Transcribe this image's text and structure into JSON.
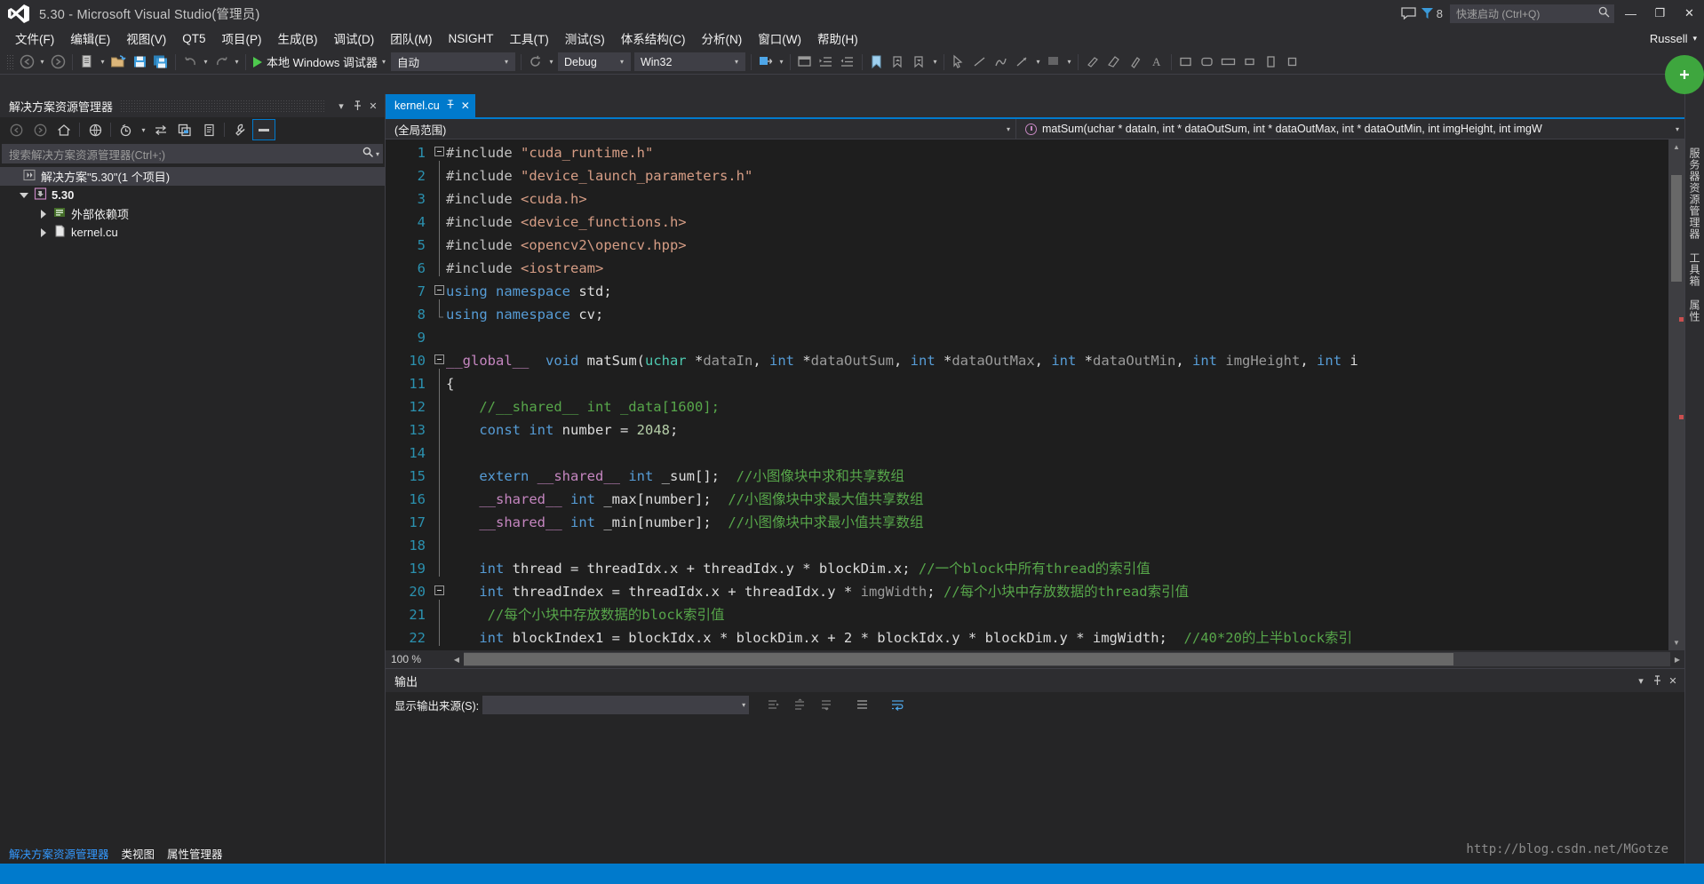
{
  "window": {
    "title": "5.30 - Microsoft Visual Studio(管理员)",
    "logo_name": "visual-studio-logo",
    "notification_count": "8",
    "minimize": "—",
    "maximize": "❐",
    "close": "✕",
    "user": "Russell",
    "user_caret": "▾"
  },
  "quick_launch": {
    "placeholder": "快速启动 (Ctrl+Q)",
    "value": "",
    "icon": "search-icon"
  },
  "menu": {
    "items": [
      {
        "label": "文件(F)",
        "mnemonic": "F"
      },
      {
        "label": "编辑(E)",
        "mnemonic": "E"
      },
      {
        "label": "视图(V)",
        "mnemonic": "V"
      },
      {
        "label": "QT5",
        "mnemonic": "T"
      },
      {
        "label": "项目(P)",
        "mnemonic": "P"
      },
      {
        "label": "生成(B)",
        "mnemonic": "B"
      },
      {
        "label": "调试(D)",
        "mnemonic": "D"
      },
      {
        "label": "团队(M)",
        "mnemonic": "M"
      },
      {
        "label": "NSIGHT",
        "mnemonic": "N"
      },
      {
        "label": "工具(T)",
        "mnemonic": "T"
      },
      {
        "label": "测试(S)",
        "mnemonic": "S"
      },
      {
        "label": "体系结构(C)",
        "mnemonic": "C"
      },
      {
        "label": "分析(N)",
        "mnemonic": "N"
      },
      {
        "label": "窗口(W)",
        "mnemonic": "W"
      },
      {
        "label": "帮助(H)",
        "mnemonic": "H"
      }
    ]
  },
  "toolbar": {
    "navigate_back": "navigate-back-icon",
    "navigate_forward": "navigate-forward-icon",
    "new_project": "new-project-icon",
    "open_file": "open-file-icon",
    "save": "save-icon",
    "save_all": "save-all-icon",
    "undo": "undo-icon",
    "redo": "redo-icon",
    "start_debug_label": "本地 Windows 调试器",
    "debug_target": "自动",
    "refresh": "refresh-icon",
    "configuration": "Debug",
    "platform": "Win32"
  },
  "solution_explorer": {
    "title": "解决方案资源管理器",
    "dropdown_icon": "chevron-down-icon",
    "pin_icon": "pin-icon",
    "close_icon": "close-icon",
    "toolbar_icons": [
      "back-icon",
      "forward-icon",
      "home-icon",
      "pending-changes-icon",
      "show-all-files-icon",
      "refresh-icon",
      "collapse-all-icon",
      "view-code-icon",
      "properties-icon",
      "preview-selected-items-icon"
    ],
    "search_placeholder": "搜索解决方案资源管理器(Ctrl+;)",
    "search_value": "",
    "tree": [
      {
        "label": "解决方案\"5.30\"(1 个项目)",
        "icon": "solution-icon",
        "indent": 0,
        "expander": "none",
        "selected": true,
        "bold": false
      },
      {
        "label": "5.30",
        "icon": "project-icon",
        "indent": 1,
        "expander": "down",
        "selected": false,
        "bold": true
      },
      {
        "label": "外部依赖项",
        "icon": "external-dependencies-icon",
        "indent": 2,
        "expander": "right",
        "selected": false,
        "bold": false
      },
      {
        "label": "kernel.cu",
        "icon": "cuda-file-icon",
        "indent": 2,
        "expander": "right",
        "selected": false,
        "bold": false
      }
    ],
    "bottom_tabs": [
      {
        "label": "解决方案资源管理器",
        "active": true
      },
      {
        "label": "类视图",
        "active": false
      },
      {
        "label": "属性管理器",
        "active": false
      }
    ]
  },
  "editor": {
    "tab": {
      "label": "kernel.cu",
      "pin": "pin-icon",
      "close": "✕"
    },
    "nav_scope": "(全局范围)",
    "nav_member": "matSum(uchar * dataIn, int * dataOutSum, int * dataOutMax, int * dataOutMin, int imgHeight, int imgW",
    "nav_member_icon": "method-icon",
    "zoom_level": "100 %",
    "lines": [
      {
        "n": 1,
        "fold": "minus",
        "tokens": [
          [
            "pp",
            "#include "
          ],
          [
            "str",
            "\"cuda_runtime.h\""
          ]
        ]
      },
      {
        "n": 2,
        "fold": "bar",
        "tokens": [
          [
            "pp",
            "#include "
          ],
          [
            "str",
            "\"device_launch_parameters.h\""
          ]
        ]
      },
      {
        "n": 3,
        "fold": "bar",
        "tokens": [
          [
            "pp",
            "#include "
          ],
          [
            "str",
            "<cuda.h>"
          ]
        ]
      },
      {
        "n": 4,
        "fold": "bar",
        "tokens": [
          [
            "pp",
            "#include "
          ],
          [
            "str",
            "<device_functions.h>"
          ]
        ]
      },
      {
        "n": 5,
        "fold": "bar",
        "tokens": [
          [
            "pp",
            "#include "
          ],
          [
            "str",
            "<opencv2\\opencv.hpp>"
          ]
        ]
      },
      {
        "n": 6,
        "fold": "bar",
        "tokens": [
          [
            "pp",
            "#include "
          ],
          [
            "str",
            "<iostream>"
          ]
        ]
      },
      {
        "n": 7,
        "fold": "minus",
        "tokens": [
          [
            "k",
            "using"
          ],
          [
            "id",
            " "
          ],
          [
            "k",
            "namespace"
          ],
          [
            "id",
            " std;"
          ]
        ]
      },
      {
        "n": 8,
        "fold": "end",
        "tokens": [
          [
            "k",
            "using"
          ],
          [
            "id",
            " "
          ],
          [
            "k",
            "namespace"
          ],
          [
            "id",
            " cv;"
          ]
        ]
      },
      {
        "n": 9,
        "fold": "none",
        "tokens": []
      },
      {
        "n": 10,
        "fold": "minus",
        "tokens": [
          [
            "kp",
            "__global__"
          ],
          [
            "id",
            "  "
          ],
          [
            "k",
            "void"
          ],
          [
            "id",
            " matSum("
          ],
          [
            "ty",
            "uchar"
          ],
          [
            "id",
            " *"
          ],
          [
            "gy",
            "dataIn"
          ],
          [
            "id",
            ", "
          ],
          [
            "k",
            "int"
          ],
          [
            "id",
            " *"
          ],
          [
            "gy",
            "dataOutSum"
          ],
          [
            "id",
            ", "
          ],
          [
            "k",
            "int"
          ],
          [
            "id",
            " *"
          ],
          [
            "gy",
            "dataOutMax"
          ],
          [
            "id",
            ", "
          ],
          [
            "k",
            "int"
          ],
          [
            "id",
            " *"
          ],
          [
            "gy",
            "dataOutMin"
          ],
          [
            "id",
            ", "
          ],
          [
            "k",
            "int"
          ],
          [
            "id",
            " "
          ],
          [
            "gy",
            "imgHeight"
          ],
          [
            "id",
            ", "
          ],
          [
            "k",
            "int"
          ],
          [
            "id",
            " i"
          ]
        ]
      },
      {
        "n": 11,
        "fold": "bar",
        "tokens": [
          [
            "id",
            "{"
          ]
        ]
      },
      {
        "n": 12,
        "fold": "bar",
        "tokens": [
          [
            "id",
            "    "
          ],
          [
            "cm",
            "//__shared__ int _data[1600];"
          ]
        ]
      },
      {
        "n": 13,
        "fold": "bar",
        "tokens": [
          [
            "id",
            "    "
          ],
          [
            "k",
            "const"
          ],
          [
            "id",
            " "
          ],
          [
            "k",
            "int"
          ],
          [
            "id",
            " number = "
          ],
          [
            "num",
            "2048"
          ],
          [
            "id",
            ";"
          ]
        ]
      },
      {
        "n": 14,
        "fold": "bar",
        "tokens": []
      },
      {
        "n": 15,
        "fold": "bar",
        "tokens": [
          [
            "id",
            "    "
          ],
          [
            "k",
            "extern"
          ],
          [
            "id",
            " "
          ],
          [
            "kp",
            "__shared__"
          ],
          [
            "id",
            " "
          ],
          [
            "k",
            "int"
          ],
          [
            "id",
            " _sum[];  "
          ],
          [
            "cm",
            "//小图像块中求和共享数组"
          ]
        ]
      },
      {
        "n": 16,
        "fold": "bar",
        "tokens": [
          [
            "id",
            "    "
          ],
          [
            "kp",
            "__shared__"
          ],
          [
            "id",
            " "
          ],
          [
            "k",
            "int"
          ],
          [
            "id",
            " _max[number];  "
          ],
          [
            "cm",
            "//小图像块中求最大值共享数组"
          ]
        ]
      },
      {
        "n": 17,
        "fold": "bar",
        "tokens": [
          [
            "id",
            "    "
          ],
          [
            "kp",
            "__shared__"
          ],
          [
            "id",
            " "
          ],
          [
            "k",
            "int"
          ],
          [
            "id",
            " _min[number];  "
          ],
          [
            "cm",
            "//小图像块中求最小值共享数组"
          ]
        ]
      },
      {
        "n": 18,
        "fold": "bar",
        "tokens": []
      },
      {
        "n": 19,
        "fold": "bar",
        "tokens": [
          [
            "id",
            "    "
          ],
          [
            "k",
            "int"
          ],
          [
            "id",
            " thread = threadIdx.x + threadIdx.y * blockDim.x; "
          ],
          [
            "cm",
            "//一个"
          ],
          [
            "cm",
            "block"
          ],
          [
            "cm",
            "中所有"
          ],
          [
            "cm",
            "thread"
          ],
          [
            "cm",
            "的索引值"
          ]
        ]
      },
      {
        "n": 20,
        "fold": "minus",
        "tokens": [
          [
            "id",
            "    "
          ],
          [
            "k",
            "int"
          ],
          [
            "id",
            " threadIndex = threadIdx.x + threadIdx.y * "
          ],
          [
            "gy",
            "imgWidth"
          ],
          [
            "id",
            "; "
          ],
          [
            "cm",
            "//每个小块中存放数据的thread索引值"
          ]
        ]
      },
      {
        "n": 21,
        "fold": "bar",
        "tokens": [
          [
            "id",
            "     "
          ],
          [
            "cm",
            "//每个小块中存放数据的block索引值"
          ]
        ]
      },
      {
        "n": 22,
        "fold": "bar",
        "tokens": [
          [
            "id",
            "    "
          ],
          [
            "k",
            "int"
          ],
          [
            "id",
            " blockIndex1 = blockIdx.x * blockDim.x + 2 * blockIdx.y * blockDim.y * imgWidth;  "
          ],
          [
            "cm",
            "//40*20的上半block索引"
          ]
        ]
      }
    ]
  },
  "output": {
    "title": "输出",
    "dropdown_icon": "chevron-down-icon",
    "pin_icon": "pin-icon",
    "close_icon": "close-icon",
    "source_label": "显示输出来源(S):",
    "source_value": "",
    "toolbar_icons": [
      "go-to-message-icon",
      "previous-message-icon",
      "next-message-icon",
      "clear-all-icon",
      "toggle-word-wrap-icon"
    ],
    "body_text": "",
    "watermark": "http://blog.csdn.net/MGotze"
  },
  "right_rail": {
    "tabs": [
      "服务器资源管理器",
      "工具箱",
      "属性"
    ]
  },
  "colors": {
    "accent": "#007acc",
    "titlebar_bg": "#2d2d30",
    "editor_bg": "#1e1e1e",
    "panel_bg": "#252526",
    "comment_green": "#57a64a",
    "keyword_blue": "#569cd6",
    "macro_magenta": "#c586c0",
    "string_orange": "#d69d85",
    "linenum_teal": "#2b91af"
  }
}
